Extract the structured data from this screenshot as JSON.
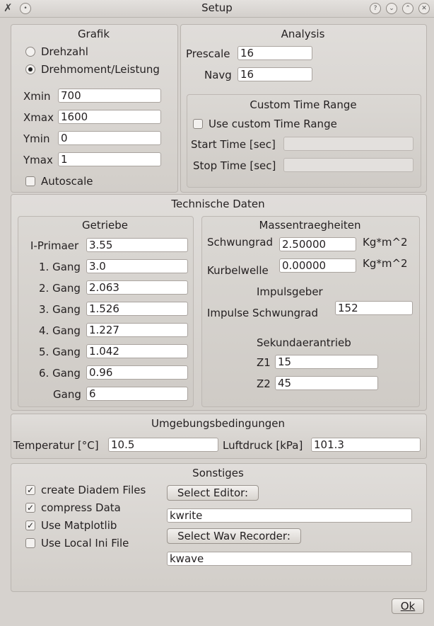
{
  "window": {
    "title": "Setup"
  },
  "grafik": {
    "title": "Grafik",
    "radio_drehzahl": "Drehzahl",
    "radio_drehmoment": "Drehmoment/Leistung",
    "xmin_label": "Xmin",
    "xmin": "700",
    "xmax_label": "Xmax",
    "xmax": "1600",
    "ymin_label": "Ymin",
    "ymin": "0",
    "ymax_label": "Ymax",
    "ymax": "1",
    "autoscale": "Autoscale"
  },
  "analysis": {
    "title": "Analysis",
    "prescale_label": "Prescale",
    "prescale": "16",
    "navg_label": "Navg",
    "navg": "16",
    "custom_title": "Custom Time Range",
    "use_custom": "Use custom Time Range",
    "start_label": "Start Time [sec]",
    "stop_label": "Stop Time [sec]"
  },
  "technische": {
    "title": "Technische Daten",
    "getriebe": {
      "title": "Getriebe",
      "rows": [
        {
          "label": "I-Primaer",
          "value": "3.55"
        },
        {
          "label": "1. Gang",
          "value": "3.0"
        },
        {
          "label": "2. Gang",
          "value": "2.063"
        },
        {
          "label": "3. Gang",
          "value": "1.526"
        },
        {
          "label": "4. Gang",
          "value": "1.227"
        },
        {
          "label": "5. Gang",
          "value": "1.042"
        },
        {
          "label": "6. Gang",
          "value": "0.96"
        },
        {
          "label": "Gang",
          "value": "6"
        }
      ]
    },
    "massen": {
      "title": "Massentraegheiten",
      "schwungrad_label": "Schwungrad",
      "schwungrad": "2.50000",
      "unit1": "Kg*m^2",
      "kurbelwelle_label": "Kurbelwelle",
      "kurbelwelle": "0.00000",
      "unit2": "Kg*m^2",
      "impulsgeber_title": "Impulsgeber",
      "impulse_label": "Impulse Schwungrad",
      "impulse": "152",
      "sekundaer_title": "Sekundaerantrieb",
      "z1_label": "Z1",
      "z1": "15",
      "z2_label": "Z2",
      "z2": "45"
    }
  },
  "umgebung": {
    "title": "Umgebungsbedingungen",
    "temp_label": "Temperatur [°C]",
    "temp": "10.5",
    "druck_label": "Luftdruck [kPa]",
    "druck": "101.3"
  },
  "sonstiges": {
    "title": "Sonstiges",
    "diadem": "create Diadem Files",
    "compress": "compress Data",
    "matplotlib": "Use Matplotlib",
    "local_ini": "Use Local Ini File",
    "select_editor": "Select Editor:",
    "editor": "kwrite",
    "select_wav": "Select Wav Recorder:",
    "wav": "kwave"
  },
  "ok": "Ok",
  "checks": {
    "mark": "✓"
  }
}
